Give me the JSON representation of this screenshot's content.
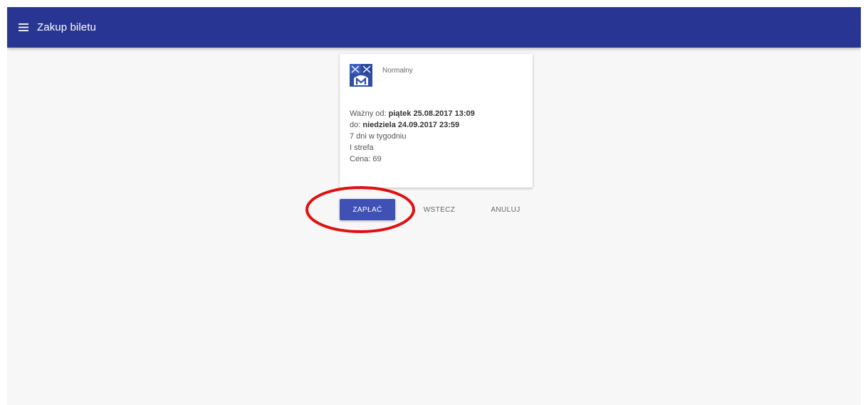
{
  "appbar": {
    "title": "Zakup biletu",
    "menu_icon": "hamburger-menu-icon",
    "background": "#283593"
  },
  "ticket": {
    "type": "Normalny",
    "logo_icon": "city-transport-logo-icon",
    "valid_from_label": "Ważny od:",
    "valid_from_value": "piątek 25.08.2017 13:09",
    "valid_to_label": "do:",
    "valid_to_value": "niedziela 24.09.2017 23:59",
    "days": "7 dni w tygodniu",
    "zone": "I strefa",
    "price_label": "Cena:",
    "price_value": "69"
  },
  "actions": {
    "pay_label": "ZAPŁAĆ",
    "back_label": "WSTECZ",
    "cancel_label": "ANULUJ",
    "accent": "#3f51b5"
  },
  "annotation": {
    "color": "#e01010"
  }
}
